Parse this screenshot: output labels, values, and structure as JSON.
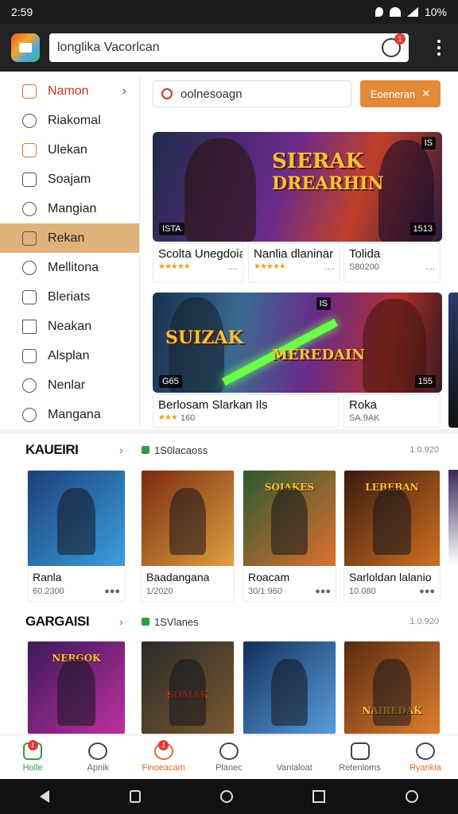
{
  "status": {
    "time": "2:59",
    "battery": "10%"
  },
  "browser": {
    "address": "longlika Vacorlcan",
    "notif_count": "1"
  },
  "sidebar": {
    "items": [
      {
        "label": "Namon"
      },
      {
        "label": "Riakomal"
      },
      {
        "label": "Ulekan"
      },
      {
        "label": "Soajam"
      },
      {
        "label": "Mangian"
      },
      {
        "label": "Rekan"
      },
      {
        "label": "Mellitona"
      },
      {
        "label": "Bleriats"
      },
      {
        "label": "Neakan"
      },
      {
        "label": "Alsplan"
      },
      {
        "label": "Nenlar"
      },
      {
        "label": "Mangana"
      }
    ]
  },
  "search": {
    "placeholder": "oolnesoagn",
    "button_label": "Eoeneran"
  },
  "banner1": {
    "title_line1": "SIERAK",
    "title_line2": "DREARHIN",
    "badge_left": "ISTA",
    "badge_right": "1513",
    "badge_top": "IS"
  },
  "banner1_cards": [
    {
      "title": "Scolta Unegdoia",
      "stars": "★★★★★",
      "meta": "...."
    },
    {
      "title": "Nanlia dlaninar",
      "stars": "★★★★★",
      "meta": "...."
    },
    {
      "title": "Tolida",
      "stars": "",
      "meta": "S80200"
    }
  ],
  "banner2": {
    "title_line1": "SUIZAK",
    "title_line2": "MEREDAIN",
    "badge_left": "G65",
    "badge_right": "155",
    "badge_top": "IS"
  },
  "banner2_cards": [
    {
      "title": "Berlosam Slarkan Ils",
      "stars": "★★★",
      "meta": "160"
    },
    {
      "title": "Roka",
      "stars": "",
      "meta": "SA.9AK"
    }
  ],
  "section1": {
    "title": "KAUEIRI",
    "pill": "1S0lacaoss",
    "count": "1.0.920"
  },
  "section1_cards": [
    {
      "name": "Ranla",
      "sub": "60.2300",
      "art_title": "",
      "c1": "#1d3f7a",
      "c2": "#3aa0e0"
    },
    {
      "name": "Baadangana",
      "sub": "1/2020",
      "art_title": "",
      "c1": "#7a2a10",
      "c2": "#e0a040"
    },
    {
      "name": "Roacam",
      "sub": "30/1.960",
      "art_title": "SOIAKES",
      "c1": "#2a5a30",
      "c2": "#e07030"
    },
    {
      "name": "Sarloldan lalanio",
      "sub": "10.080",
      "art_title": "LEBEBAN",
      "c1": "#3a1a10",
      "c2": "#d07020"
    }
  ],
  "section2": {
    "title": "GARGAISI",
    "pill": "1SVlanes",
    "count": "1.0.920"
  },
  "section2_cards": [
    {
      "art_title": "NERGOK",
      "c1": "#3a1a5a",
      "c2": "#c030a0"
    },
    {
      "art_title": "SOMAK",
      "c1": "#2a2a2a",
      "c2": "#7a5a30"
    },
    {
      "art_title": "",
      "c1": "#12305a",
      "c2": "#5aa0e0"
    },
    {
      "art_title": "NAIREDAK",
      "c1": "#5a2a10",
      "c2": "#e08030"
    }
  ],
  "bottomnav": [
    {
      "label": "Holle",
      "badge": "1"
    },
    {
      "label": "Apnik",
      "badge": ""
    },
    {
      "label": "Finoeacam",
      "badge": "1"
    },
    {
      "label": "Planec",
      "badge": ""
    },
    {
      "label": "Vanlaloat",
      "badge": ""
    },
    {
      "label": "Retenloms",
      "badge": ""
    },
    {
      "label": "Ryarikia",
      "badge": ""
    }
  ]
}
